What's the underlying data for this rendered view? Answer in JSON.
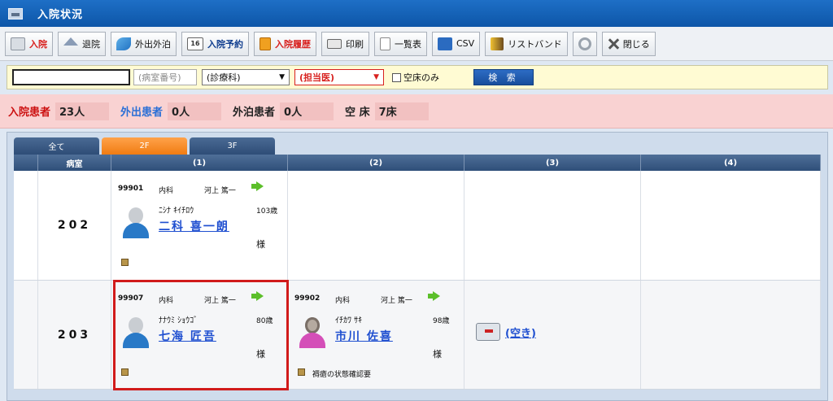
{
  "window": {
    "title": "入院状況"
  },
  "toolbar": {
    "admit": "入院",
    "discharge": "退院",
    "outing": "外出外泊",
    "reserve_icon_text": "16",
    "reserve": "入院予約",
    "history": "入院履歴",
    "print": "印刷",
    "list": "一覧表",
    "csv": "CSV",
    "wristband": "リストバンド",
    "close": "閉じる"
  },
  "search": {
    "keyword_value": "",
    "room_placeholder": "(病室番号)",
    "department": "(診療科)",
    "doctor": "(担当医)",
    "vacant_only": "空床のみ",
    "search_button": "検 索"
  },
  "counts": {
    "inpatients_label": "入院患者",
    "inpatients_value": "23人",
    "outing_label": "外出患者",
    "outing_value": "0人",
    "overnight_label": "外泊患者",
    "overnight_value": "0人",
    "vacant_label": "空 床",
    "vacant_value": "7床"
  },
  "tabs": [
    {
      "label": "全て",
      "active": false
    },
    {
      "label": "2F",
      "active": true
    },
    {
      "label": "3F",
      "active": false
    }
  ],
  "grid": {
    "headers": [
      "",
      "病室",
      "(1)",
      "(2)",
      "(3)",
      "(4)"
    ],
    "rows": [
      {
        "room": "202",
        "beds": [
          {
            "id": "99901",
            "dept": "内科",
            "doctor": "河上 篤一",
            "kana": "ﾆｼﾅ ｷｲﾁﾛｳ",
            "age": "103歳",
            "name": "二科 喜一朗",
            "suffix": "様",
            "note": ""
          }
        ]
      },
      {
        "room": "203",
        "beds": [
          {
            "id": "99907",
            "dept": "内科",
            "doctor": "河上 篤一",
            "kana": "ﾅﾅｳﾐ ｼｮｳｺﾞ",
            "age": "80歳",
            "name": "七海 匠吾",
            "suffix": "様",
            "note": ""
          },
          {
            "id": "99902",
            "dept": "内科",
            "doctor": "河上 篤一",
            "kana": "ｲﾁｶﾜ ｻｷ",
            "age": "98歳",
            "name": "市川 佐喜",
            "suffix": "様",
            "note": "褥瘡の状態確認要"
          },
          {
            "vacant_label": "(空き)"
          }
        ]
      }
    ]
  },
  "colors": {
    "title_bar": "#0d56a8",
    "highlight": "#d11b1b",
    "active_tab": "#f07c12",
    "counts_bg": "#f9d2d2",
    "search_bg": "#fffbd3"
  }
}
